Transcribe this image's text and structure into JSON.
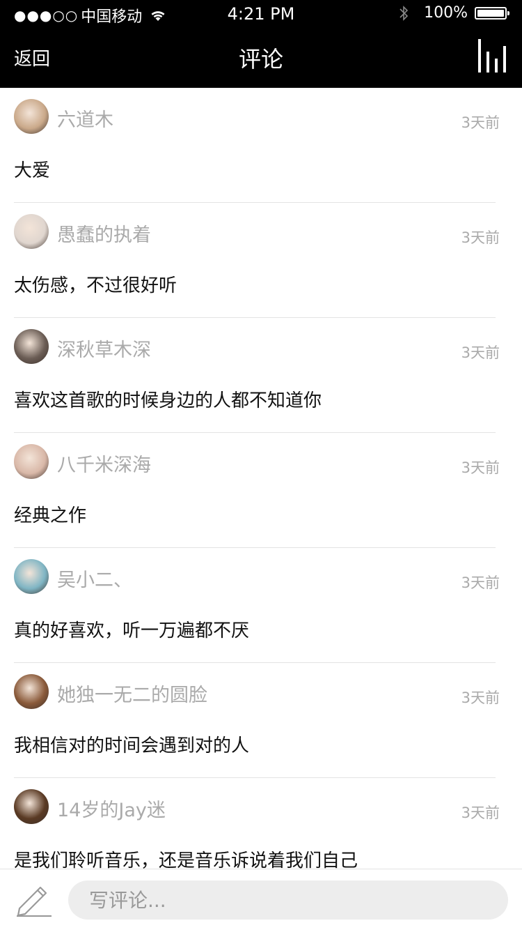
{
  "status_bar": {
    "signal_dots": "●●●○○",
    "carrier": "中国移动",
    "time": "4:21 PM",
    "battery": "100%"
  },
  "nav": {
    "back_label": "返回",
    "title": "评论",
    "right_icon": "equalizer-icon"
  },
  "comments": [
    {
      "user": "六道木",
      "time": "3天前",
      "text": "大爱",
      "avatar_color": "#caa98a"
    },
    {
      "user": "愚蠢的执着",
      "time": "3天前",
      "text": "太伤感，不过很好听",
      "avatar_color": "#e0d6cf"
    },
    {
      "user": "深秋草木深",
      "time": "3天前",
      "text": "喜欢这首歌的时候身边的人都不知道你",
      "avatar_color": "#6b5d55"
    },
    {
      "user": "八千米深海",
      "time": "3天前",
      "text": "经典之作",
      "avatar_color": "#d9b8a8"
    },
    {
      "user": "吴小二、",
      "time": "3天前",
      "text": "真的好喜欢，听一万遍都不厌",
      "avatar_color": "#7fb5c4"
    },
    {
      "user": "她独一无二的圆脸",
      "time": "3天前",
      "text": "我相信对的时间会遇到对的人",
      "avatar_color": "#8a5a3a"
    },
    {
      "user": "14岁的Jay迷",
      "time": "3天前",
      "text": "是我们聆听音乐，还是音乐诉说着我们自己",
      "avatar_color": "#5a3a24"
    }
  ],
  "bottom": {
    "placeholder": "写评论..."
  }
}
